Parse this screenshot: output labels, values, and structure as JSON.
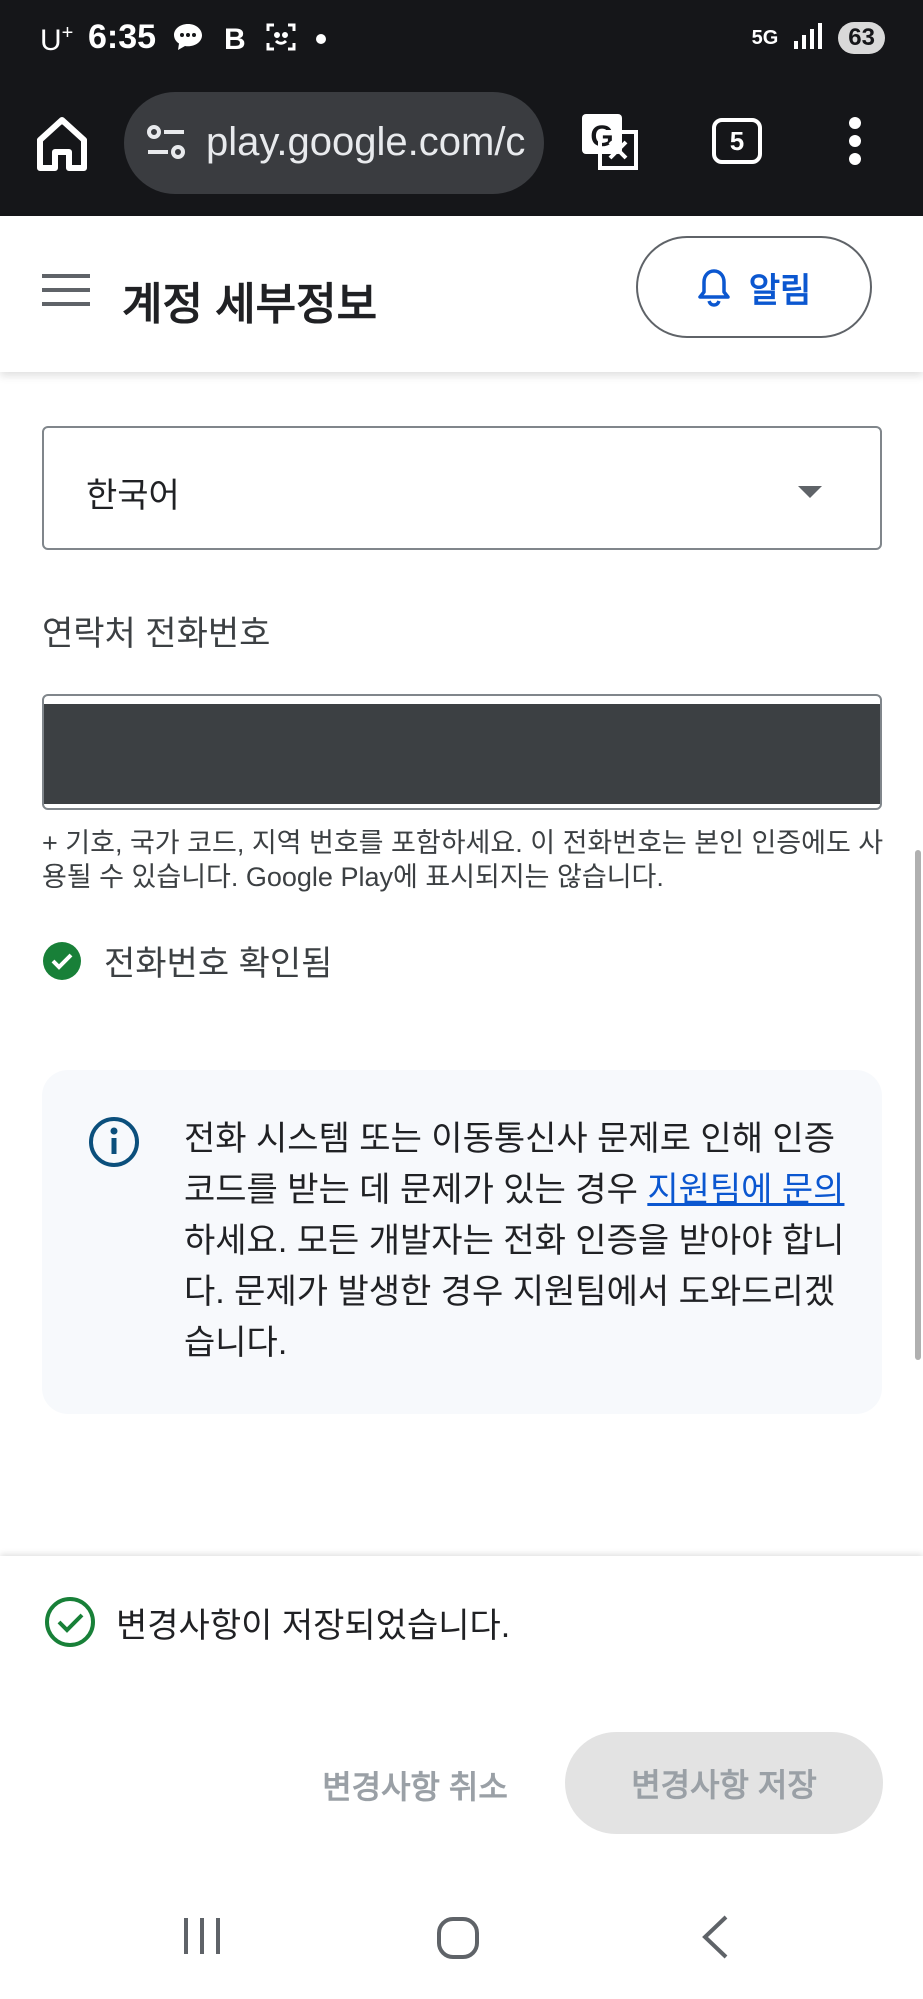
{
  "status_bar": {
    "carrier": "U",
    "carrier_sup": "+",
    "time": "6:35",
    "network": "5G",
    "battery": "63"
  },
  "browser": {
    "url": "play.google.com/c",
    "tab_count": "5"
  },
  "header": {
    "title": "계정 세부정보",
    "notifications_label": "알림"
  },
  "form": {
    "language_value": "한국어",
    "phone_label": "연락처 전화번호",
    "phone_help": "+ 기호, 국가 코드, 지역 번호를 포함하세요. 이 전화번호는 본인 인증에도 사용될 수 있습니다. Google Play에 표시되지는 않습니다.",
    "phone_verified": "전화번호 확인됨"
  },
  "info": {
    "text_before": "전화 시스템 또는 이동통신사 문제로 인해 인증 코드를 받는 데 문제가 있는 경우 ",
    "link": "지원팀에 문의",
    "text_after": "하세요. 모든 개발자는 전화 인증을 받아야 합니다. 문제가 발생한 경우 지원팀에서 도와드리겠습니다."
  },
  "bottom": {
    "saved_message": "변경사항이 저장되었습니다.",
    "discard_label": "변경사항 취소",
    "save_label": "변경사항 저장"
  },
  "colors": {
    "accent": "#0b57d0",
    "success": "#188038",
    "status_bar_bg": "#151619"
  }
}
